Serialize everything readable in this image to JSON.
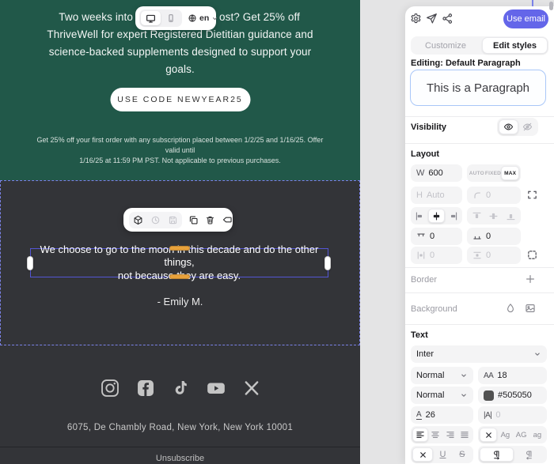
{
  "colors": {
    "email_hero_bg": "#215849",
    "email_body_bg": "#333438",
    "accent": "#6466E9",
    "selection_dashed": "#7B82E8",
    "selection_solid": "#5456D5",
    "handle_orange": "#E8A23C"
  },
  "email": {
    "device_toolbar": {
      "language": "en"
    },
    "hero": {
      "line1_left": "Two weeks into",
      "line1_right": "ost? Get 25% off",
      "line2": "ThriveWell for expert Registered Dietitian guidance and",
      "line3": "science-backed supplements designed to support your",
      "line4": "goals.",
      "button_label": "USE CODE NEWYEAR25",
      "fine_print_line1": "Get 25% off your first order with any subscription placed between 1/2/25 and 1/16/25. Offer valid until",
      "fine_print_line2": "1/16/25 at 11:59 PM PST. Not applicable to previous purchases."
    },
    "quote": {
      "line1": "We choose to go to the moon in this decade and do the other things,",
      "line2": "not because they are easy.",
      "attribution": "- Emily M."
    },
    "footer": {
      "address": "6075, De Chambly Road, New York, New York 10001",
      "unsubscribe_label": "Unsubscribe",
      "social_icons": [
        "instagram",
        "facebook",
        "tiktok",
        "youtube",
        "x"
      ]
    }
  },
  "panel": {
    "actions": {
      "use_email_label": "Use email"
    },
    "tabs": {
      "customize": "Customize",
      "edit_styles": "Edit styles"
    },
    "editing_label": "Editing: Default Paragraph",
    "preview_text": "This is a Paragraph",
    "sections": {
      "visibility": {
        "label": "Visibility"
      },
      "layout": {
        "heading": "Layout",
        "width": {
          "label": "W",
          "value": "600"
        },
        "width_mode": {
          "options": [
            "AUTO",
            "FIXED",
            "MAX"
          ],
          "active": "MAX"
        },
        "height": {
          "label": "H",
          "placeholder": "Auto"
        },
        "corner_radius": {
          "value": "0"
        },
        "padding_top": {
          "value": "0"
        },
        "padding_bottom": {
          "value": "0"
        },
        "padding_horizontal": {
          "value": "0"
        },
        "padding_vertical": {
          "value": "0"
        }
      },
      "border": {
        "label": "Border"
      },
      "background": {
        "label": "Background"
      },
      "text": {
        "heading": "Text",
        "font_family": "Inter",
        "font_weight": "Normal",
        "font_size": {
          "label": "AA",
          "value": "18"
        },
        "font_style": "Normal",
        "color_hex": "#505050",
        "line_height": {
          "label": "A",
          "value": "26"
        },
        "letter_spacing": {
          "label": "|A|",
          "value": "0"
        },
        "case_options": [
          "Ag",
          "AG",
          "ag"
        ]
      }
    },
    "glyphs": {
      "underline": "U",
      "strikethrough": "S"
    }
  }
}
